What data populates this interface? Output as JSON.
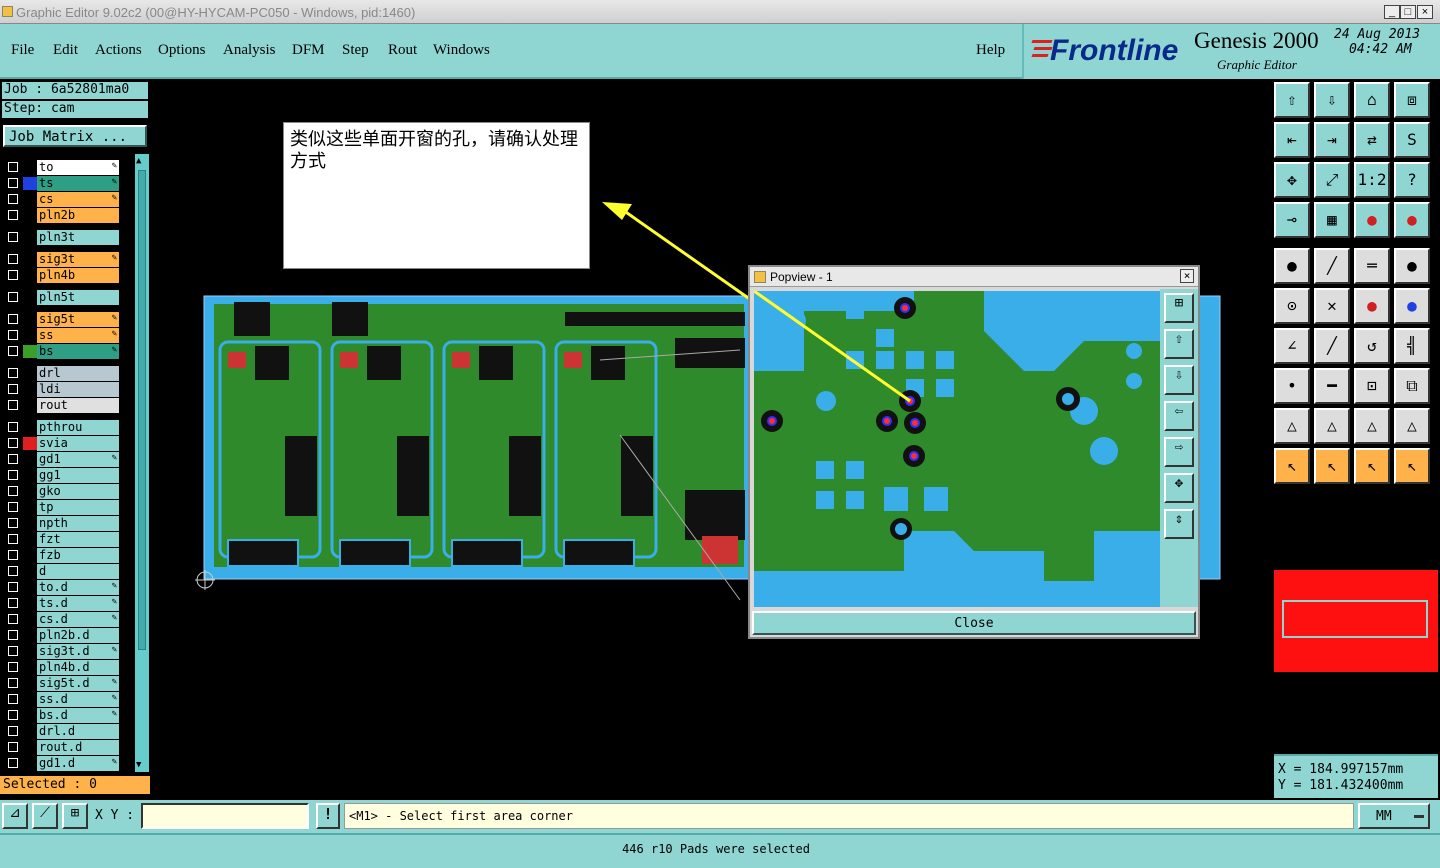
{
  "window": {
    "title": "Graphic Editor 9.02c2 (00@HY-HYCAM-PC050 - Windows, pid:1460)"
  },
  "menu": [
    "File",
    "Edit",
    "Actions",
    "Options",
    "Analysis",
    "DFM",
    "Step",
    "Rout",
    "Windows"
  ],
  "help": "Help",
  "brand": {
    "logo": "Frontline",
    "product": "Genesis 2000",
    "subtitle": "Graphic Editor",
    "date": "24 Aug 2013",
    "time": "04:42 AM"
  },
  "job": {
    "job": "Job : 6a52801ma0",
    "step": "Step: cam",
    "matrix_btn": "Job Matrix ..."
  },
  "layers": [
    {
      "name": "to",
      "bg": "#ffffff",
      "swatch": "#000000",
      "pen": true
    },
    {
      "name": "ts",
      "bg": "#2e9f84",
      "swatch": "#2040e0",
      "pen": true
    },
    {
      "name": "cs",
      "bg": "#ffb24a",
      "swatch": "#000000",
      "pen": true
    },
    {
      "name": "pln2b",
      "bg": "#ffb24a",
      "swatch": "#000000",
      "pen": false
    },
    {
      "name": "pln3t",
      "bg": "#8fd6d3",
      "swatch": "#000000",
      "pen": false
    },
    {
      "name": "sig3t",
      "bg": "#ffb24a",
      "swatch": "#000000",
      "pen": true
    },
    {
      "name": "pln4b",
      "bg": "#ffb24a",
      "swatch": "#000000",
      "pen": false
    },
    {
      "name": "pln5t",
      "bg": "#8fd6d3",
      "swatch": "#000000",
      "pen": false
    },
    {
      "name": "sig5t",
      "bg": "#ffb24a",
      "swatch": "#000000",
      "pen": true
    },
    {
      "name": "ss",
      "bg": "#ffb24a",
      "swatch": "#000000",
      "pen": true
    },
    {
      "name": "bs",
      "bg": "#2e9f84",
      "swatch": "#3aa02a",
      "pen": true
    },
    {
      "name": "drl",
      "bg": "#b8c8d0",
      "swatch": "#000000",
      "pen": false
    },
    {
      "name": "ldi",
      "bg": "#b8c8d0",
      "swatch": "#000000",
      "pen": false
    },
    {
      "name": "rout",
      "bg": "#e0e0e0",
      "swatch": "#000000",
      "pen": false
    },
    {
      "name": "pthrou",
      "bg": "#8fd6d3",
      "swatch": "#000000",
      "pen": false
    },
    {
      "name": "svia",
      "bg": "#8fd6d3",
      "swatch": "#e02020",
      "pen": false
    },
    {
      "name": "gd1",
      "bg": "#8fd6d3",
      "swatch": "#000000",
      "pen": true
    },
    {
      "name": "gg1",
      "bg": "#8fd6d3",
      "swatch": "#000000",
      "pen": false
    },
    {
      "name": "gko",
      "bg": "#8fd6d3",
      "swatch": "#000000",
      "pen": false
    },
    {
      "name": "tp",
      "bg": "#8fd6d3",
      "swatch": "#000000",
      "pen": false
    },
    {
      "name": "npth",
      "bg": "#8fd6d3",
      "swatch": "#000000",
      "pen": false
    },
    {
      "name": "fzt",
      "bg": "#8fd6d3",
      "swatch": "#000000",
      "pen": false
    },
    {
      "name": "fzb",
      "bg": "#8fd6d3",
      "swatch": "#000000",
      "pen": false
    },
    {
      "name": "d",
      "bg": "#8fd6d3",
      "swatch": "#000000",
      "pen": false
    },
    {
      "name": "to.d",
      "bg": "#8fd6d3",
      "swatch": "#000000",
      "pen": true
    },
    {
      "name": "ts.d",
      "bg": "#8fd6d3",
      "swatch": "#000000",
      "pen": true
    },
    {
      "name": "cs.d",
      "bg": "#8fd6d3",
      "swatch": "#000000",
      "pen": true
    },
    {
      "name": "pln2b.d",
      "bg": "#8fd6d3",
      "swatch": "#000000",
      "pen": false
    },
    {
      "name": "sig3t.d",
      "bg": "#8fd6d3",
      "swatch": "#000000",
      "pen": true
    },
    {
      "name": "pln4b.d",
      "bg": "#8fd6d3",
      "swatch": "#000000",
      "pen": false
    },
    {
      "name": "sig5t.d",
      "bg": "#8fd6d3",
      "swatch": "#000000",
      "pen": true
    },
    {
      "name": "ss.d",
      "bg": "#8fd6d3",
      "swatch": "#000000",
      "pen": true
    },
    {
      "name": "bs.d",
      "bg": "#8fd6d3",
      "swatch": "#000000",
      "pen": true
    },
    {
      "name": "drl.d",
      "bg": "#8fd6d3",
      "swatch": "#000000",
      "pen": false
    },
    {
      "name": "rout.d",
      "bg": "#8fd6d3",
      "swatch": "#000000",
      "pen": false
    },
    {
      "name": "gd1.d",
      "bg": "#8fd6d3",
      "swatch": "#000000",
      "pen": true
    }
  ],
  "selected": "Selected : 0",
  "annotation": "类似这些单面开窗的孔，请确认处理方式",
  "popview": {
    "title": "Popview - 1",
    "close": "Close"
  },
  "coords": {
    "x": "X  =  184.997157mm",
    "y": "Y  =  181.432400mm"
  },
  "bottom": {
    "xy_label": "X Y :",
    "xy_value": "",
    "prompt": "<M1> - Select first area corner",
    "units": "MM",
    "status": "446 r10 Pads were selected"
  }
}
